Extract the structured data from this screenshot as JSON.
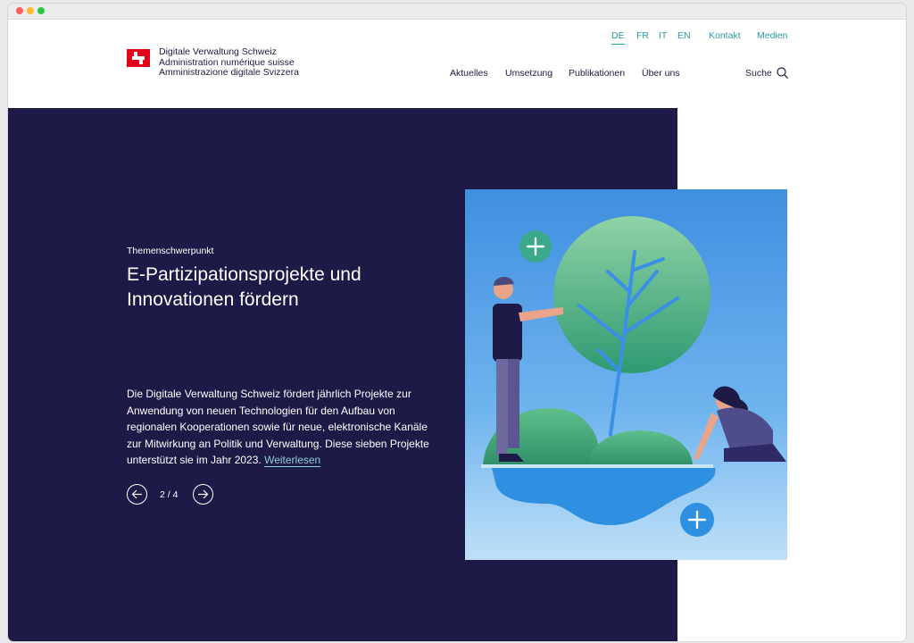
{
  "header": {
    "org_names": [
      "Digitale Verwaltung Schweiz",
      "Administration numérique suisse",
      "Amministrazione digitale Svizzera"
    ],
    "languages": [
      "DE",
      "FR",
      "IT",
      "EN"
    ],
    "active_language": "DE",
    "top_links": [
      "Kontakt",
      "Medien"
    ],
    "nav": [
      "Aktuelles",
      "Umsetzung",
      "Publikationen",
      "Über uns"
    ],
    "search_label": "Suche"
  },
  "hero": {
    "eyebrow": "Themenschwerpunkt",
    "title": "E-Partizipationsprojekte und Innovationen fördern",
    "description": "Die Digitale Verwaltung Schweiz fördert jährlich Projekte zur Anwendung von neuen Technologien für den Aufbau von regionalen Kooperationen sowie für neue, elektronische Kanäle zur Mitwirkung an Politik und Verwaltung. Diese sieben Projekte unterstützt sie im Jahr 2023.",
    "read_more": "Weiterlesen",
    "slide_counter": "2 / 4"
  },
  "icons": {
    "logo": "swiss-cross-logo",
    "search": "search-icon",
    "prev": "arrow-left-icon",
    "next": "arrow-right-icon"
  },
  "colors": {
    "hero_bg": "#1e1a47",
    "accent": "#2a9aa2",
    "brand_red": "#e2001a",
    "text_dark": "#1e1a3f"
  }
}
